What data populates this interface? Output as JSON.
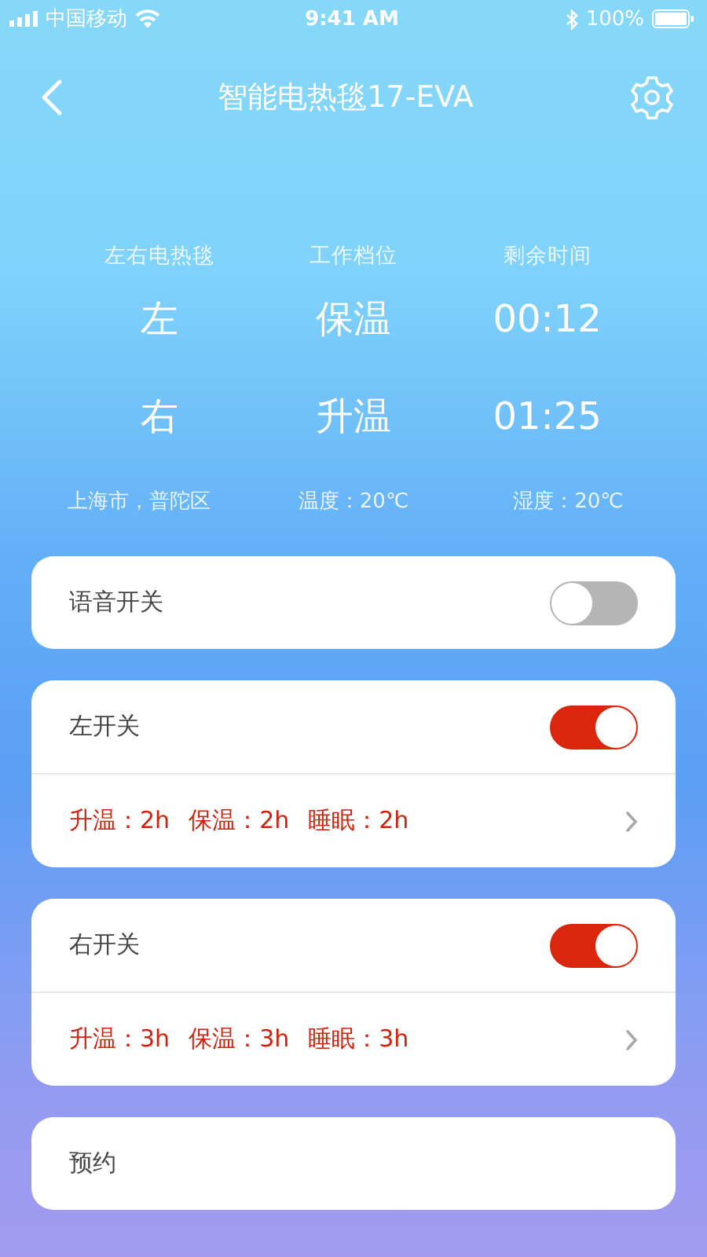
{
  "status_bar": {
    "carrier": "中国移动",
    "time": "9:41 AM",
    "battery": "100%"
  },
  "header": {
    "title": "智能电热毯17-EVA"
  },
  "overview": {
    "columns": [
      "左右电热毯",
      "工作档位",
      "剩余时间"
    ],
    "rows": [
      [
        "左",
        "保温",
        "00:12"
      ],
      [
        "右",
        "升温",
        "01:25"
      ]
    ],
    "info": [
      "上海市，普陀区",
      "温度：20℃",
      "湿度：20℃"
    ]
  },
  "cards": [
    {
      "rows": [
        {
          "kind": "switch",
          "label": "语音开关",
          "on": false
        }
      ]
    },
    {
      "rows": [
        {
          "kind": "switch",
          "label": "左开关",
          "on": true
        },
        {
          "kind": "detail",
          "items": [
            "升温：2h",
            "保温：2h",
            "睡眠：2h"
          ]
        }
      ]
    },
    {
      "rows": [
        {
          "kind": "switch",
          "label": "右开关",
          "on": true
        },
        {
          "kind": "detail",
          "items": [
            "升温：3h",
            "保温：3h",
            "睡眠：3h"
          ]
        }
      ]
    },
    {
      "rows": [
        {
          "kind": "plain",
          "label": "预约"
        }
      ]
    }
  ]
}
